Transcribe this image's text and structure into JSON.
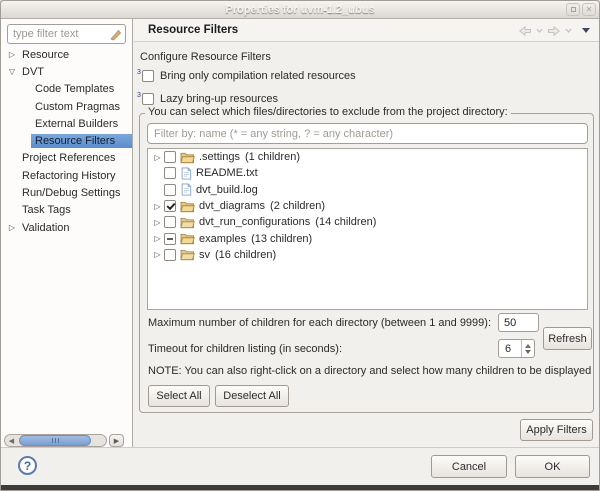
{
  "window": {
    "title": "Properties for uvm-1.2_ubus"
  },
  "sidebar": {
    "filter_placeholder": "type filter text",
    "tree": [
      {
        "label": "Resource",
        "expander": "collapsed",
        "level": 0,
        "selected": false
      },
      {
        "label": "DVT",
        "expander": "expanded",
        "level": 0,
        "selected": false
      },
      {
        "label": "Code Templates",
        "expander": "none",
        "level": 1,
        "selected": false
      },
      {
        "label": "Custom Pragmas",
        "expander": "none",
        "level": 1,
        "selected": false
      },
      {
        "label": "External Builders",
        "expander": "none",
        "level": 1,
        "selected": false
      },
      {
        "label": "Resource Filters",
        "expander": "none",
        "level": 1,
        "selected": true
      },
      {
        "label": "Project References",
        "expander": "none",
        "level": 0,
        "selected": false
      },
      {
        "label": "Refactoring History",
        "expander": "none",
        "level": 0,
        "selected": false
      },
      {
        "label": "Run/Debug Settings",
        "expander": "none",
        "level": 0,
        "selected": false
      },
      {
        "label": "Task Tags",
        "expander": "none",
        "level": 0,
        "selected": false
      },
      {
        "label": "Validation",
        "expander": "collapsed",
        "level": 0,
        "selected": false
      }
    ]
  },
  "header": {
    "title": "Resource Filters"
  },
  "main": {
    "section_title": "Configure Resource Filters",
    "options": [
      {
        "marker": "3",
        "label": "Bring only compilation related resources",
        "state": "unchecked"
      },
      {
        "marker": "3",
        "label": "Lazy bring-up resources",
        "state": "unchecked"
      }
    ],
    "group": {
      "legend": "You can select which files/directories to exclude from the project directory:",
      "filter_placeholder": "Filter by: name (* = any string, ? = any character)",
      "files": [
        {
          "name": ".settings",
          "suffix": "(1 children)",
          "type": "folder",
          "state": "unchecked",
          "expander": "collapsed"
        },
        {
          "name": "README.txt",
          "suffix": "",
          "type": "file",
          "state": "unchecked",
          "expander": "none"
        },
        {
          "name": "dvt_build.log",
          "suffix": "",
          "type": "file",
          "state": "unchecked",
          "expander": "none"
        },
        {
          "name": "dvt_diagrams",
          "suffix": "(2 children)",
          "type": "folder",
          "state": "checked",
          "expander": "collapsed"
        },
        {
          "name": "dvt_run_configurations",
          "suffix": "(14 children)",
          "type": "folder",
          "state": "unchecked",
          "expander": "collapsed"
        },
        {
          "name": "examples",
          "suffix": "(13 children)",
          "type": "folder",
          "state": "partial",
          "expander": "collapsed"
        },
        {
          "name": "sv",
          "suffix": "(16 children)",
          "type": "folder",
          "state": "unchecked",
          "expander": "collapsed"
        }
      ],
      "max_children_label": "Maximum number of children for each directory (between 1 and 9999):",
      "max_children_value": "50",
      "refresh_label": "Refresh",
      "timeout_label": "Timeout for children listing (in seconds):",
      "timeout_value": "6",
      "note": "NOTE: You can also right-click on a directory and select how many children to be displayed",
      "select_all_label": "Select All",
      "deselect_all_label": "Deselect All"
    },
    "apply_filters_label": "Apply Filters"
  },
  "footer": {
    "help_label": "?",
    "cancel_label": "Cancel",
    "ok_label": "OK"
  },
  "colors": {
    "selection_blue": "#5c8ecb",
    "marker_blue": "#27418c",
    "folder_tan": "#eac983"
  }
}
